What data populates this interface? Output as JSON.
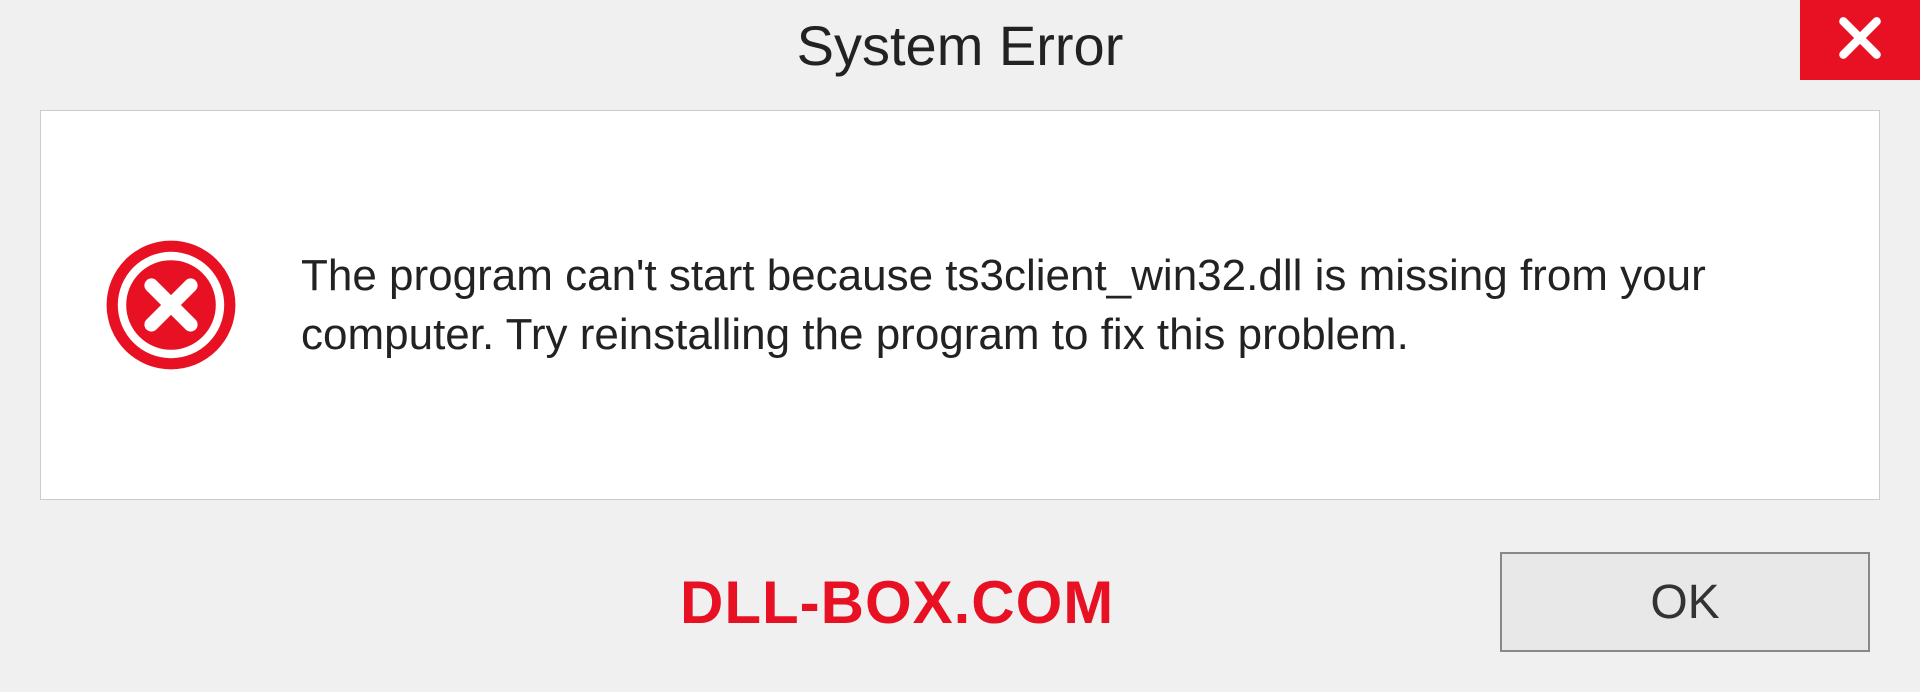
{
  "dialog": {
    "title": "System Error",
    "message": "The program can't start because ts3client_win32.dll is missing from your computer. Try reinstalling the program to fix this problem.",
    "ok_label": "OK"
  },
  "watermark": "DLL-BOX.COM",
  "colors": {
    "error_red": "#e81123",
    "background": "#f0f0f0",
    "content_bg": "#ffffff"
  }
}
